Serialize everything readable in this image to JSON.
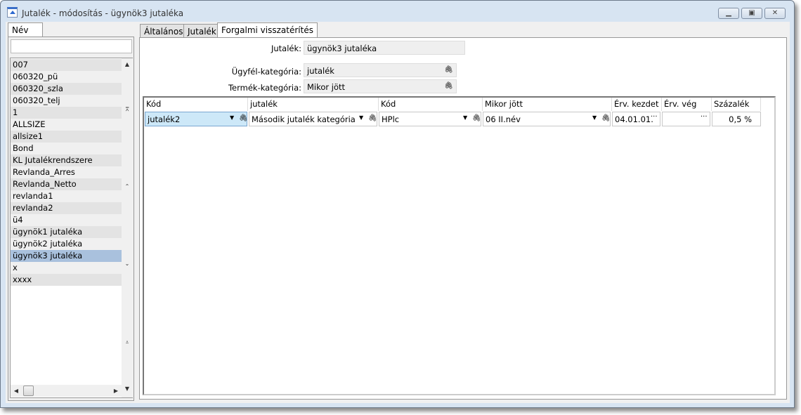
{
  "window": {
    "title": "Jutalék - módosítás - ügynök3 jutaléka",
    "minimize": "minimize",
    "maximize": "maximize",
    "close": "close"
  },
  "left": {
    "tab": "Név",
    "search_value": "",
    "items": [
      "007",
      "060320_pü",
      "060320_szla",
      "060320_telj",
      "1",
      "ALLSIZE",
      "allsize1",
      "Bond",
      "KL Jutalékrendszere",
      "Revlanda_Arres",
      "Revlanda_Netto",
      "revlanda1",
      "revlanda2",
      "ü4",
      "ügynök1 jutaléka",
      "ügynök2 jutaléka",
      "ügynök3 jutaléka",
      "x",
      "xxxx"
    ],
    "selected": "ügynök3 jutaléka"
  },
  "tabs": [
    "Általános",
    "Jutalék",
    "Forgalmi visszatérítés"
  ],
  "active_tab": "Forgalmi visszatérítés",
  "form": {
    "jutalek_label": "Jutalék:",
    "jutalek_value": "ügynök3 jutaléka",
    "ugyfel_label": "Ügyfél-kategória:",
    "ugyfel_value": "jutalék",
    "termek_label": "Termék-kategória:",
    "termek_value": "Mikor jött"
  },
  "grid": {
    "headers": [
      "Kód",
      "jutalék",
      "Kód",
      "Mikor jött",
      "Érv. kezdet",
      "Érv. vég",
      "Százalék"
    ],
    "rows": [
      {
        "kod": "jutalék2",
        "jutalek": "Második jutalék kategória",
        "kod2": "HPlc",
        "mikor": "06 II.név",
        "kezdet": "04.01.01.",
        "veg": "",
        "szazalek": "0,5 %"
      }
    ]
  },
  "colors": {
    "selected_row": "#a9c1dd",
    "active_cell": "#cde8f8",
    "frame": "#d7e4f2"
  }
}
